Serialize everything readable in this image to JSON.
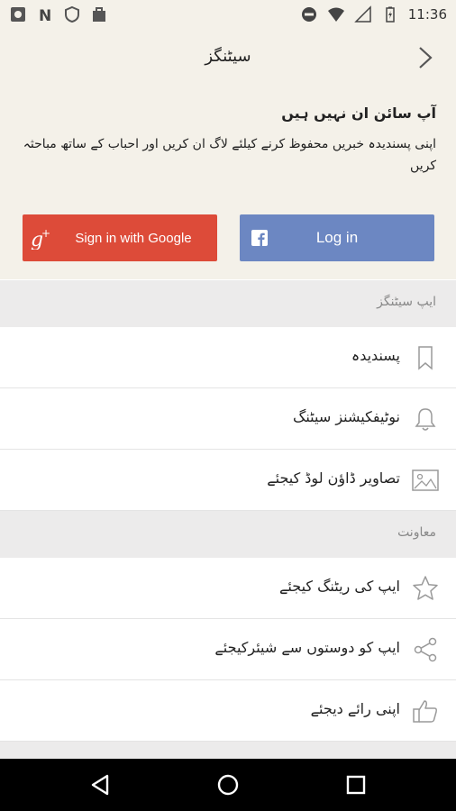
{
  "status_bar": {
    "time": "11:36"
  },
  "header": {
    "title": "سیٹنگز",
    "signed_out_title": "آپ سائن ان نہیں ہیں",
    "signed_out_desc": "اپنی پسندیدہ خبریں محفوظ کرنے کیلئے لاگ ان کریں اور احباب کے ساتھ مباحثہ کریں",
    "google_label": "Sign in with Google",
    "facebook_label": "Log in"
  },
  "sections": [
    {
      "title": "ایپ سیٹنگز",
      "items": [
        {
          "label": "پسندیدہ",
          "icon": "bookmark-icon"
        },
        {
          "label": "نوٹیفکیشنز سیٹنگ",
          "icon": "bell-icon"
        },
        {
          "label": "تصاویر ڈاؤن لوڈ کیجئے",
          "icon": "image-icon"
        }
      ]
    },
    {
      "title": "معاونت",
      "items": [
        {
          "label": "ایپ کی ریٹنگ کیجئے",
          "icon": "star-icon"
        },
        {
          "label": "ایپ کو دوستوں سے شیئرکیجئے",
          "icon": "share-icon"
        },
        {
          "label": "اپنی رائے دیجئے",
          "icon": "thumbs-up-icon"
        }
      ]
    }
  ],
  "colors": {
    "google": "#dd4b39",
    "facebook": "#6c87c2",
    "header_bg": "#f4f1e9"
  }
}
